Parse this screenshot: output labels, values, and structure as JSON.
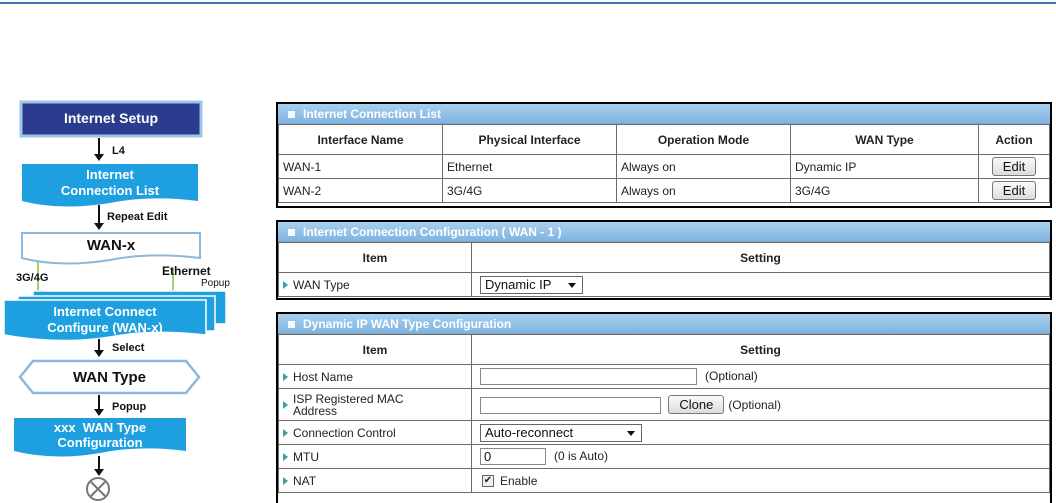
{
  "flowchart": {
    "internet_setup": "Internet Setup",
    "l4": "L4",
    "conn_list_1": "Internet",
    "conn_list_2": "Connection List",
    "repeat_edit": "Repeat Edit",
    "wan_x": "WAN-x",
    "g34": "3G/4G",
    "ethernet": "Ethernet",
    "popup1": "Popup",
    "configure_1": "Internet Connect",
    "configure_2": "Configure (WAN-x)",
    "select": "Select",
    "wan_type": "WAN Type",
    "popup2": "Popup",
    "xxx_1": "xxx  WAN Type",
    "xxx_2": "Configuration"
  },
  "list_panel": {
    "title": "Internet Connection List",
    "headers": [
      "Interface Name",
      "Physical Interface",
      "Operation Mode",
      "WAN Type",
      "Action"
    ],
    "rows": [
      {
        "name": "WAN-1",
        "physical": "Ethernet",
        "mode": "Always on",
        "wan_type": "Dynamic IP",
        "action": "Edit"
      },
      {
        "name": "WAN-2",
        "physical": "3G/4G",
        "mode": "Always on",
        "wan_type": "3G/4G",
        "action": "Edit"
      }
    ]
  },
  "config_panel": {
    "title": "Internet Connection Configuration ( WAN - 1 )",
    "col_item": "Item",
    "col_setting": "Setting",
    "wan_type_label": "WAN Type",
    "wan_type_value": "Dynamic IP"
  },
  "dyn_panel": {
    "title": "Dynamic IP WAN Type Configuration",
    "col_item": "Item",
    "col_setting": "Setting",
    "host_name_label": "Host Name",
    "host_name_value": "",
    "optional": "(Optional)",
    "mac_label_1": "ISP Registered MAC",
    "mac_label_2": "Address",
    "mac_value": "",
    "clone": "Clone",
    "conn_ctrl_label": "Connection Control",
    "conn_ctrl_value": "Auto-reconnect",
    "mtu_label": "MTU",
    "mtu_value": "0",
    "mtu_note": "(0 is Auto)",
    "nat_label": "NAT",
    "nat_enable": "Enable"
  },
  "colors": {
    "accent": "#3e78b6",
    "flow_blue": "#1e9fe0",
    "flow_dark": "#2b3c8f",
    "header_blue": "#8fc1e8"
  }
}
